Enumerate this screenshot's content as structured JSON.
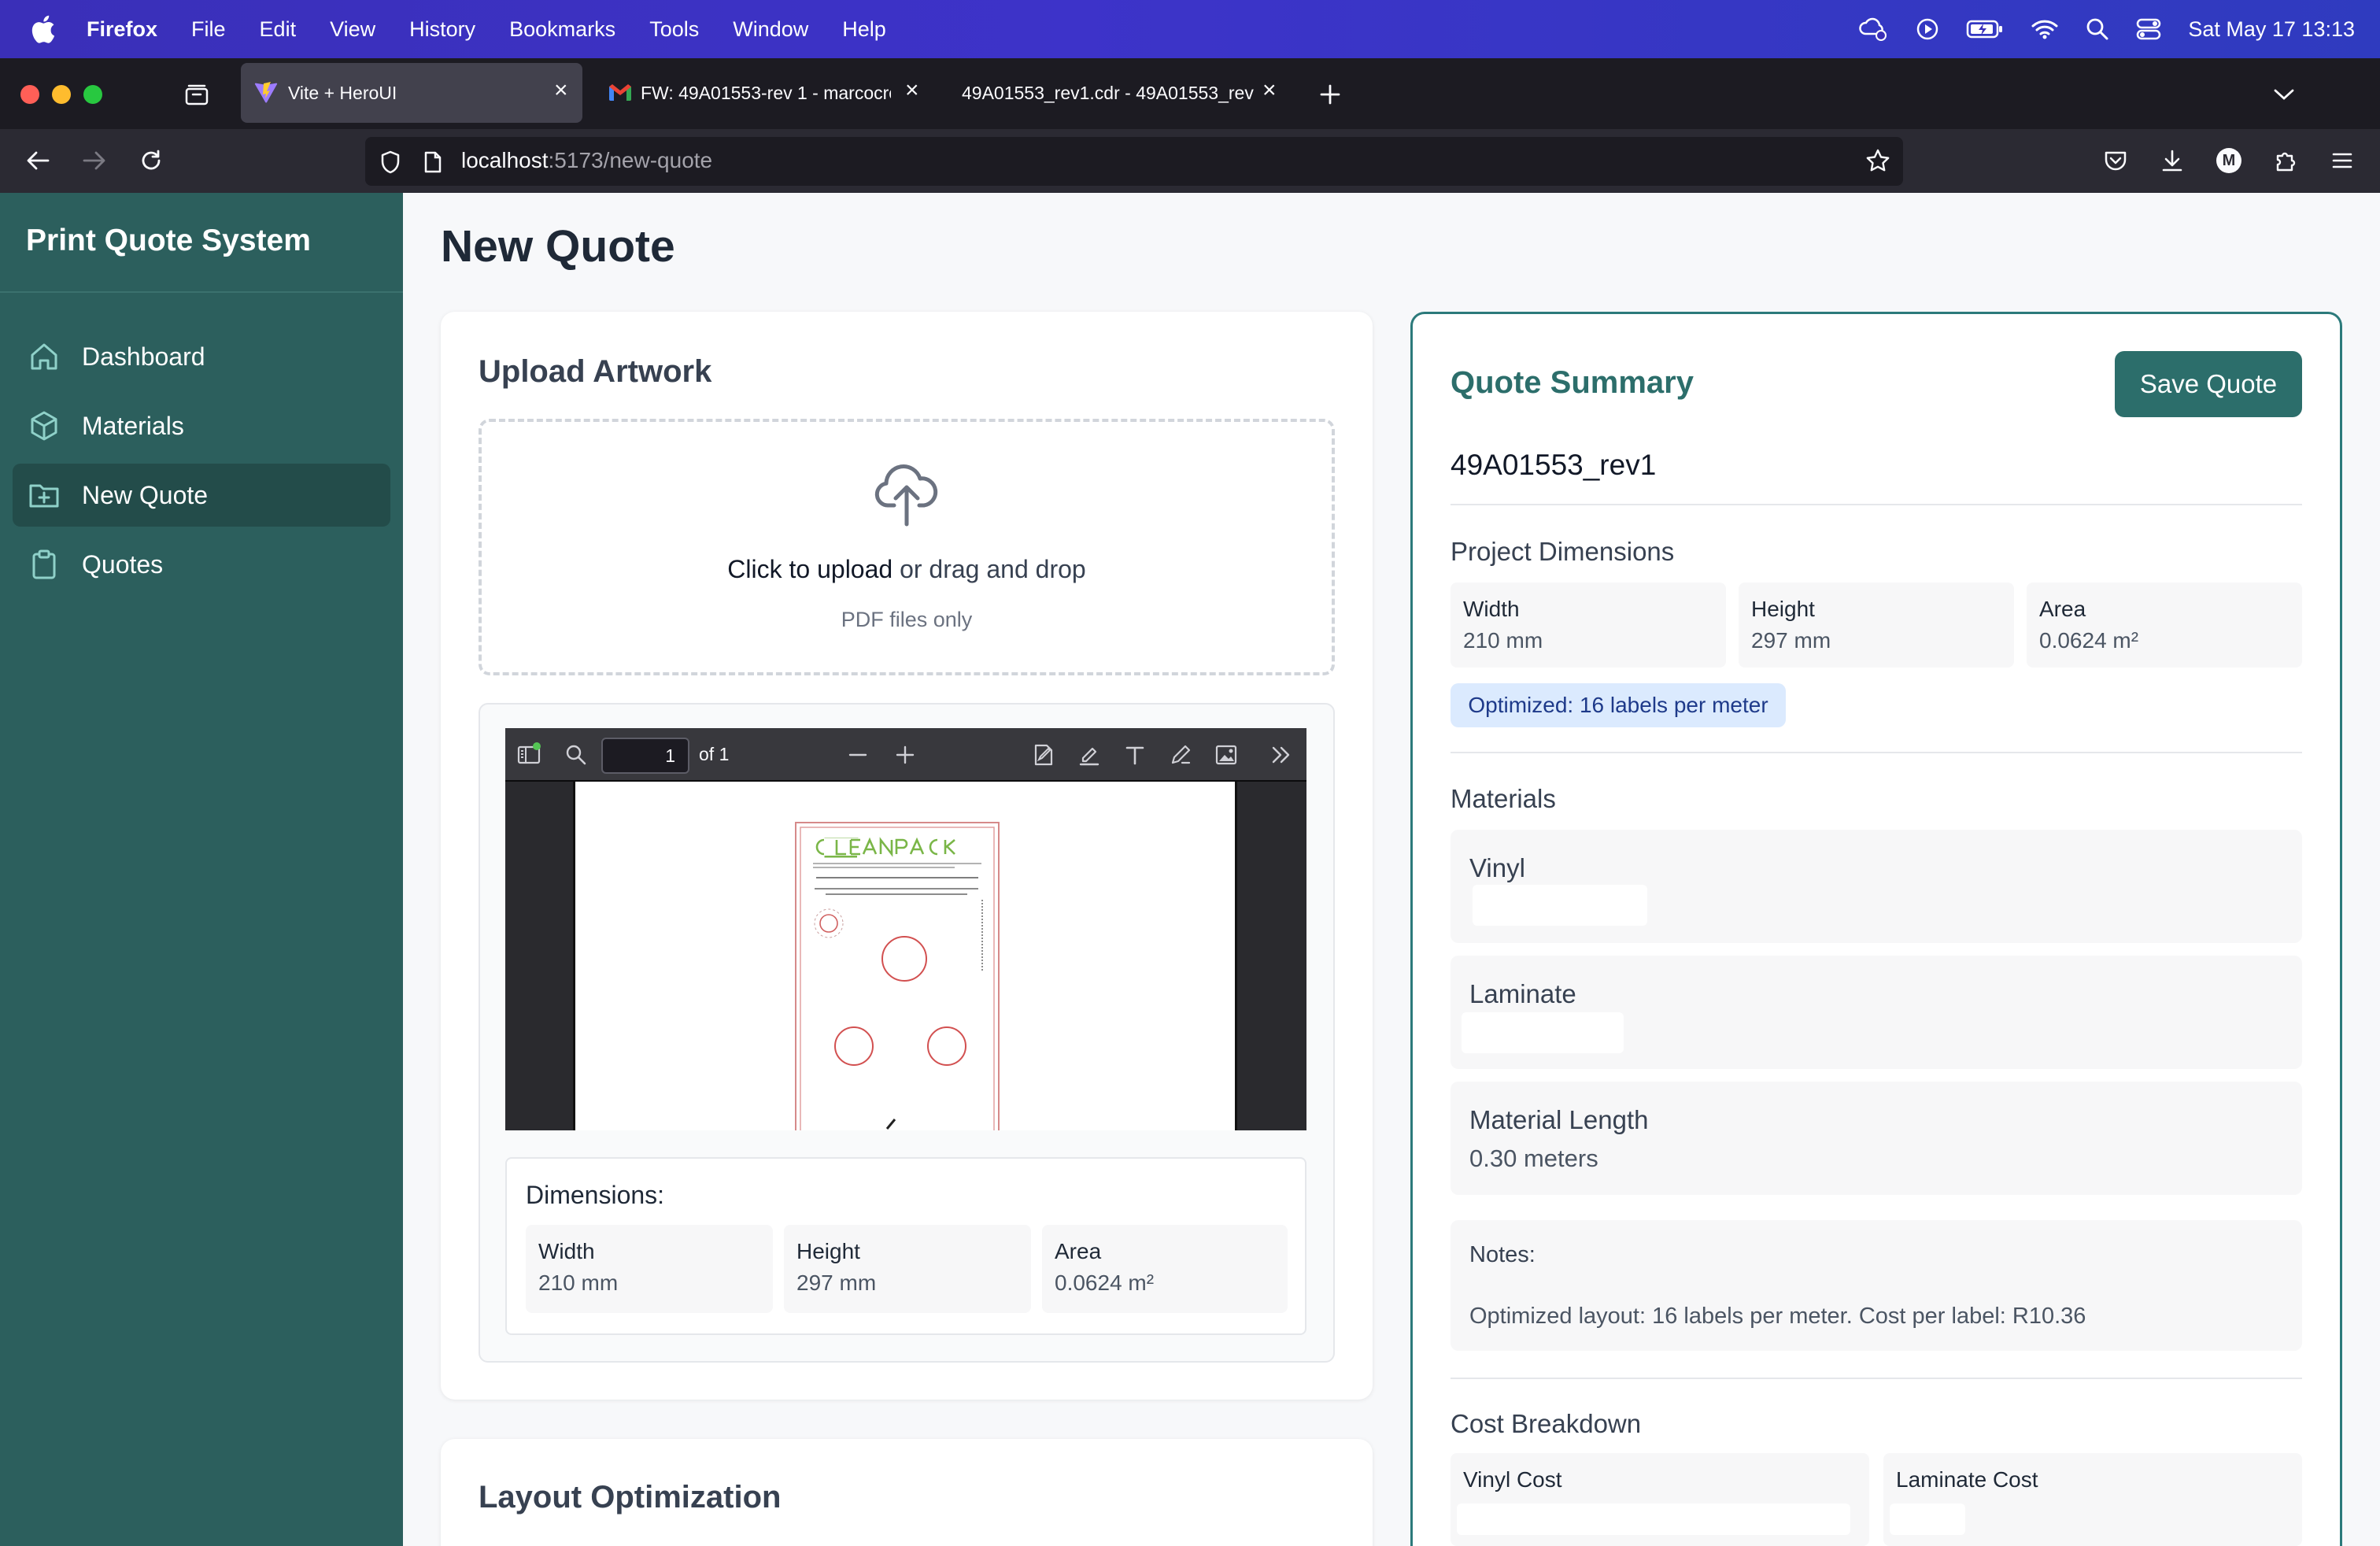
{
  "menubar": {
    "app": "Firefox",
    "items": [
      "File",
      "Edit",
      "View",
      "History",
      "Bookmarks",
      "Tools",
      "Window",
      "Help"
    ],
    "clock": "Sat May 17  13:13"
  },
  "browser": {
    "tabs": [
      {
        "title": "Vite + HeroUI",
        "active": true
      },
      {
        "title": "FW: 49A01553-rev 1 - marcocro",
        "active": false
      },
      {
        "title": "49A01553_rev1.cdr - 49A01553_rev",
        "active": false
      }
    ],
    "url_host": "localhost",
    "url_path": ":5173/new-quote",
    "profile_initial": "M"
  },
  "sidebar": {
    "brand": "Print Quote System",
    "items": [
      {
        "label": "Dashboard",
        "icon": "home-icon"
      },
      {
        "label": "Materials",
        "icon": "cube-icon"
      },
      {
        "label": "New Quote",
        "icon": "folder-plus-icon",
        "active": true
      },
      {
        "label": "Quotes",
        "icon": "clipboard-icon"
      }
    ]
  },
  "page": {
    "title": "New Quote"
  },
  "upload": {
    "title": "Upload Artwork",
    "cta_strong": "Click to upload",
    "cta_rest": " or drag and drop",
    "hint": "PDF files only"
  },
  "pdf_viewer": {
    "page_number": "1",
    "page_count": "of 1"
  },
  "dimensions": {
    "heading": "Dimensions:",
    "width_label": "Width",
    "width_value": "210 mm",
    "height_label": "Height",
    "height_value": "297 mm",
    "area_label": "Area",
    "area_value": "0.0624 m²"
  },
  "layout": {
    "title": "Layout Optimization"
  },
  "summary": {
    "title": "Quote Summary",
    "save_label": "Save Quote",
    "quote_name": "49A01553_rev1",
    "project_dimensions_heading": "Project Dimensions",
    "width_label": "Width",
    "width_value": "210 mm",
    "height_label": "Height",
    "height_value": "297 mm",
    "area_label": "Area",
    "area_value": "0.0624 m²",
    "optimized_badge": "Optimized: 16 labels per meter",
    "materials_heading": "Materials",
    "vinyl_label": "Vinyl",
    "laminate_label": "Laminate",
    "material_length_label": "Material Length",
    "material_length_value": "0.30 meters",
    "notes_label": "Notes:",
    "notes_text": "Optimized layout: 16 labels per meter. Cost per label: R10.36",
    "cost_breakdown_heading": "Cost Breakdown",
    "vinyl_cost_label": "Vinyl Cost",
    "laminate_cost_label": "Laminate Cost"
  },
  "colors": {
    "sidebar_bg": "#2c5f5d",
    "accent": "#2c6e6b",
    "badge_bg": "#dbeafe"
  }
}
